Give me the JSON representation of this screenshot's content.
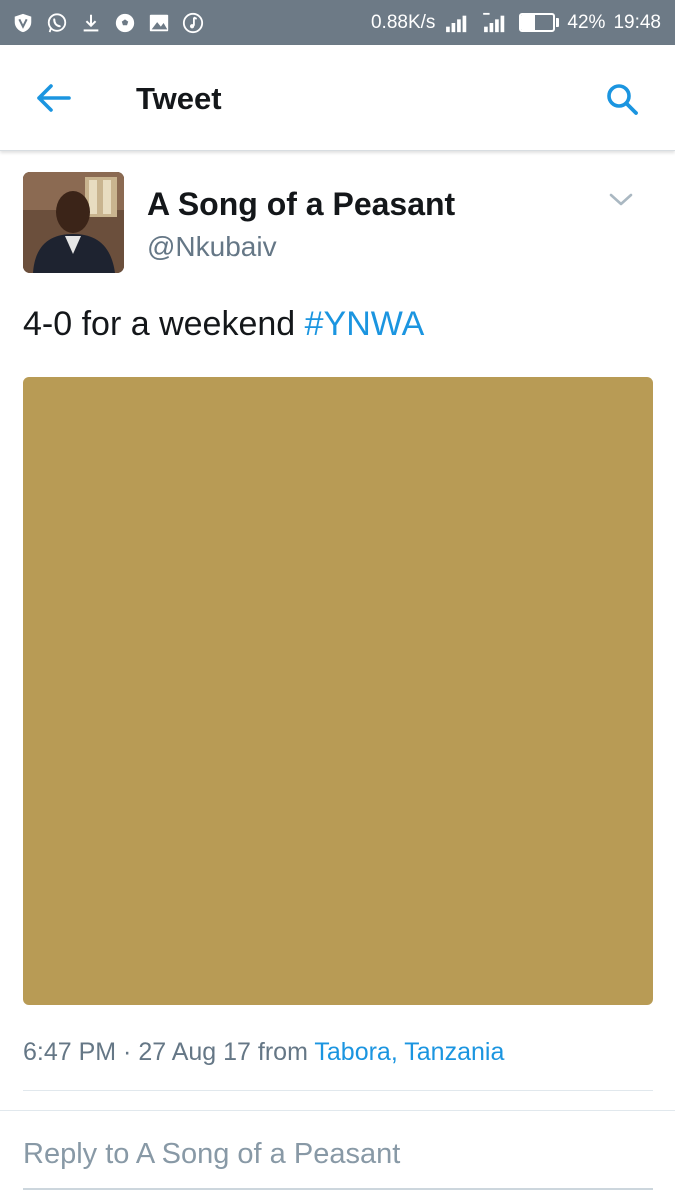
{
  "status_bar": {
    "left_icons": [
      "vpn-shield-icon",
      "whatsapp-icon",
      "download-icon",
      "soccer-ball-icon",
      "image-icon",
      "music-icon"
    ],
    "net_speed": "0.88K/s",
    "battery_percent": "42%",
    "battery_level": 0.42,
    "time": "19:48",
    "background": "#6d7a86"
  },
  "app_bar": {
    "title": "Tweet",
    "back_icon": "arrow-left-icon",
    "search_icon": "search-icon",
    "accent": "#1b95e0"
  },
  "tweet": {
    "author_name": "A Song of a Peasant",
    "author_handle": "@Nkubaiv",
    "text": "4-0 for a weekend ",
    "hashtag": "#YNWA",
    "media_color": "#b89b55",
    "timestamp": "6:47 PM · 27 Aug 17",
    "from_label": "from",
    "location": "Tabora, Tanzania"
  },
  "reply": {
    "placeholder": "Reply to A Song of a Peasant"
  }
}
